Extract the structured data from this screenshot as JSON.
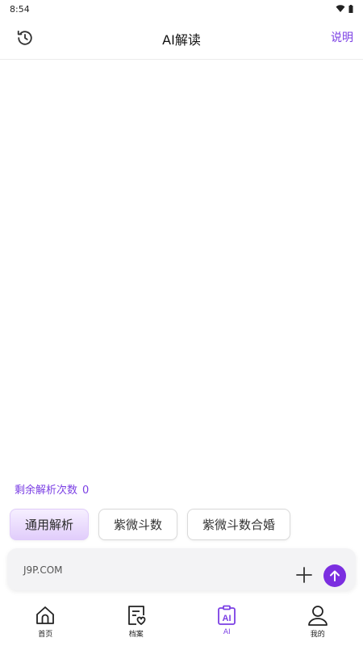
{
  "status_bar": {
    "time": "8:54"
  },
  "header": {
    "title": "AI解读",
    "help_label": "说明"
  },
  "remaining": {
    "label": "剩余解析次数",
    "count": "0"
  },
  "chips": [
    {
      "label": "通用解析",
      "active": true
    },
    {
      "label": "紫微斗数",
      "active": false
    },
    {
      "label": "紫微斗数合婚",
      "active": false
    }
  ],
  "input": {
    "placeholder": "J9P.COM"
  },
  "tabs": [
    {
      "label": "首页",
      "icon": "home-icon",
      "active": false
    },
    {
      "label": "档案",
      "icon": "profile-doc-icon",
      "active": false
    },
    {
      "label": "AI",
      "icon": "ai-icon",
      "active": true
    },
    {
      "label": "我的",
      "icon": "user-icon",
      "active": false
    }
  ],
  "colors": {
    "accent": "#7b3fe4",
    "send_button": "#7b2ee0",
    "active_chip_bg": "#e1cdfb"
  }
}
